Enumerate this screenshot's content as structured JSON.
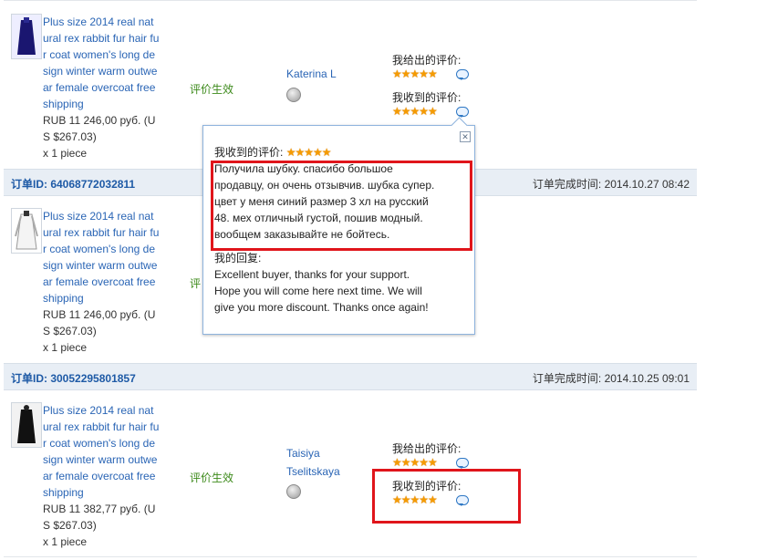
{
  "rows": [
    {
      "product_lines": [
        "Plus size 2014 real nat",
        "ural rex rabbit fur hair fu",
        "r coat women's long de",
        "sign winter warm outwe",
        "ar female overcoat free",
        "shipping"
      ],
      "price_lines": [
        "RUB 11 246,00 руб. (U",
        "S $267.03)"
      ],
      "qty": "x 1 piece",
      "status": "评价生效",
      "buyer_lines": [
        "Katerina L"
      ],
      "given_label": "我给出的评价:",
      "received_label": "我收到的评价:",
      "stars": "★★★★★"
    },
    {
      "product_lines": [
        "Plus size 2014 real nat",
        "ural rex rabbit fur hair fu",
        "r coat women's long de",
        "sign winter warm outwe",
        "ar female overcoat free",
        "shipping"
      ],
      "price_lines": [
        "RUB 11 246,00 руб. (U",
        "S $267.03)"
      ],
      "qty": "x 1 piece",
      "status": "评"
    },
    {
      "product_lines": [
        "Plus size 2014 real nat",
        "ural rex rabbit fur hair fu",
        "r coat women's long de",
        "sign winter warm outwe",
        "ar female overcoat free",
        "shipping"
      ],
      "price_lines": [
        "RUB 11 382,77 руб. (U",
        "S $267.03)"
      ],
      "qty": "x 1 piece",
      "status": "评价生效",
      "buyer_lines": [
        "Taisiya",
        "Tselitskaya"
      ],
      "given_label": "我给出的评价:",
      "received_label": "我收到的评价:",
      "stars": "★★★★★"
    }
  ],
  "orders": [
    {
      "id": "订单ID: 64068772032811",
      "time": "订单完成时间: 2014.10.27 08:42"
    },
    {
      "id": "订单ID: 30052295801857",
      "time": "订单完成时间: 2014.10.25 09:01"
    }
  ],
  "popup": {
    "title": "我收到的评价:",
    "stars": "★★★★★",
    "close_glyph": "✕",
    "review_lines": [
      "Получила шубку. спасибо большое",
      "продавцу, он очень отзывчив. шубка супер.",
      "цвет у меня синий размер 3 хл на русский",
      "48. мех отличный густой, пошив модный.",
      "вообщем заказывайте не бойтесь."
    ],
    "reply_label": "我的回复:",
    "reply_lines": [
      "Excellent buyer, thanks for your support.",
      "Hope you will come here next time. We will",
      "give you more discount. Thanks once again!"
    ]
  },
  "colors": {
    "link": "#2a65b5",
    "status": "#3d8a1b",
    "star": "#f59b00",
    "highlight": "#e0151b"
  }
}
